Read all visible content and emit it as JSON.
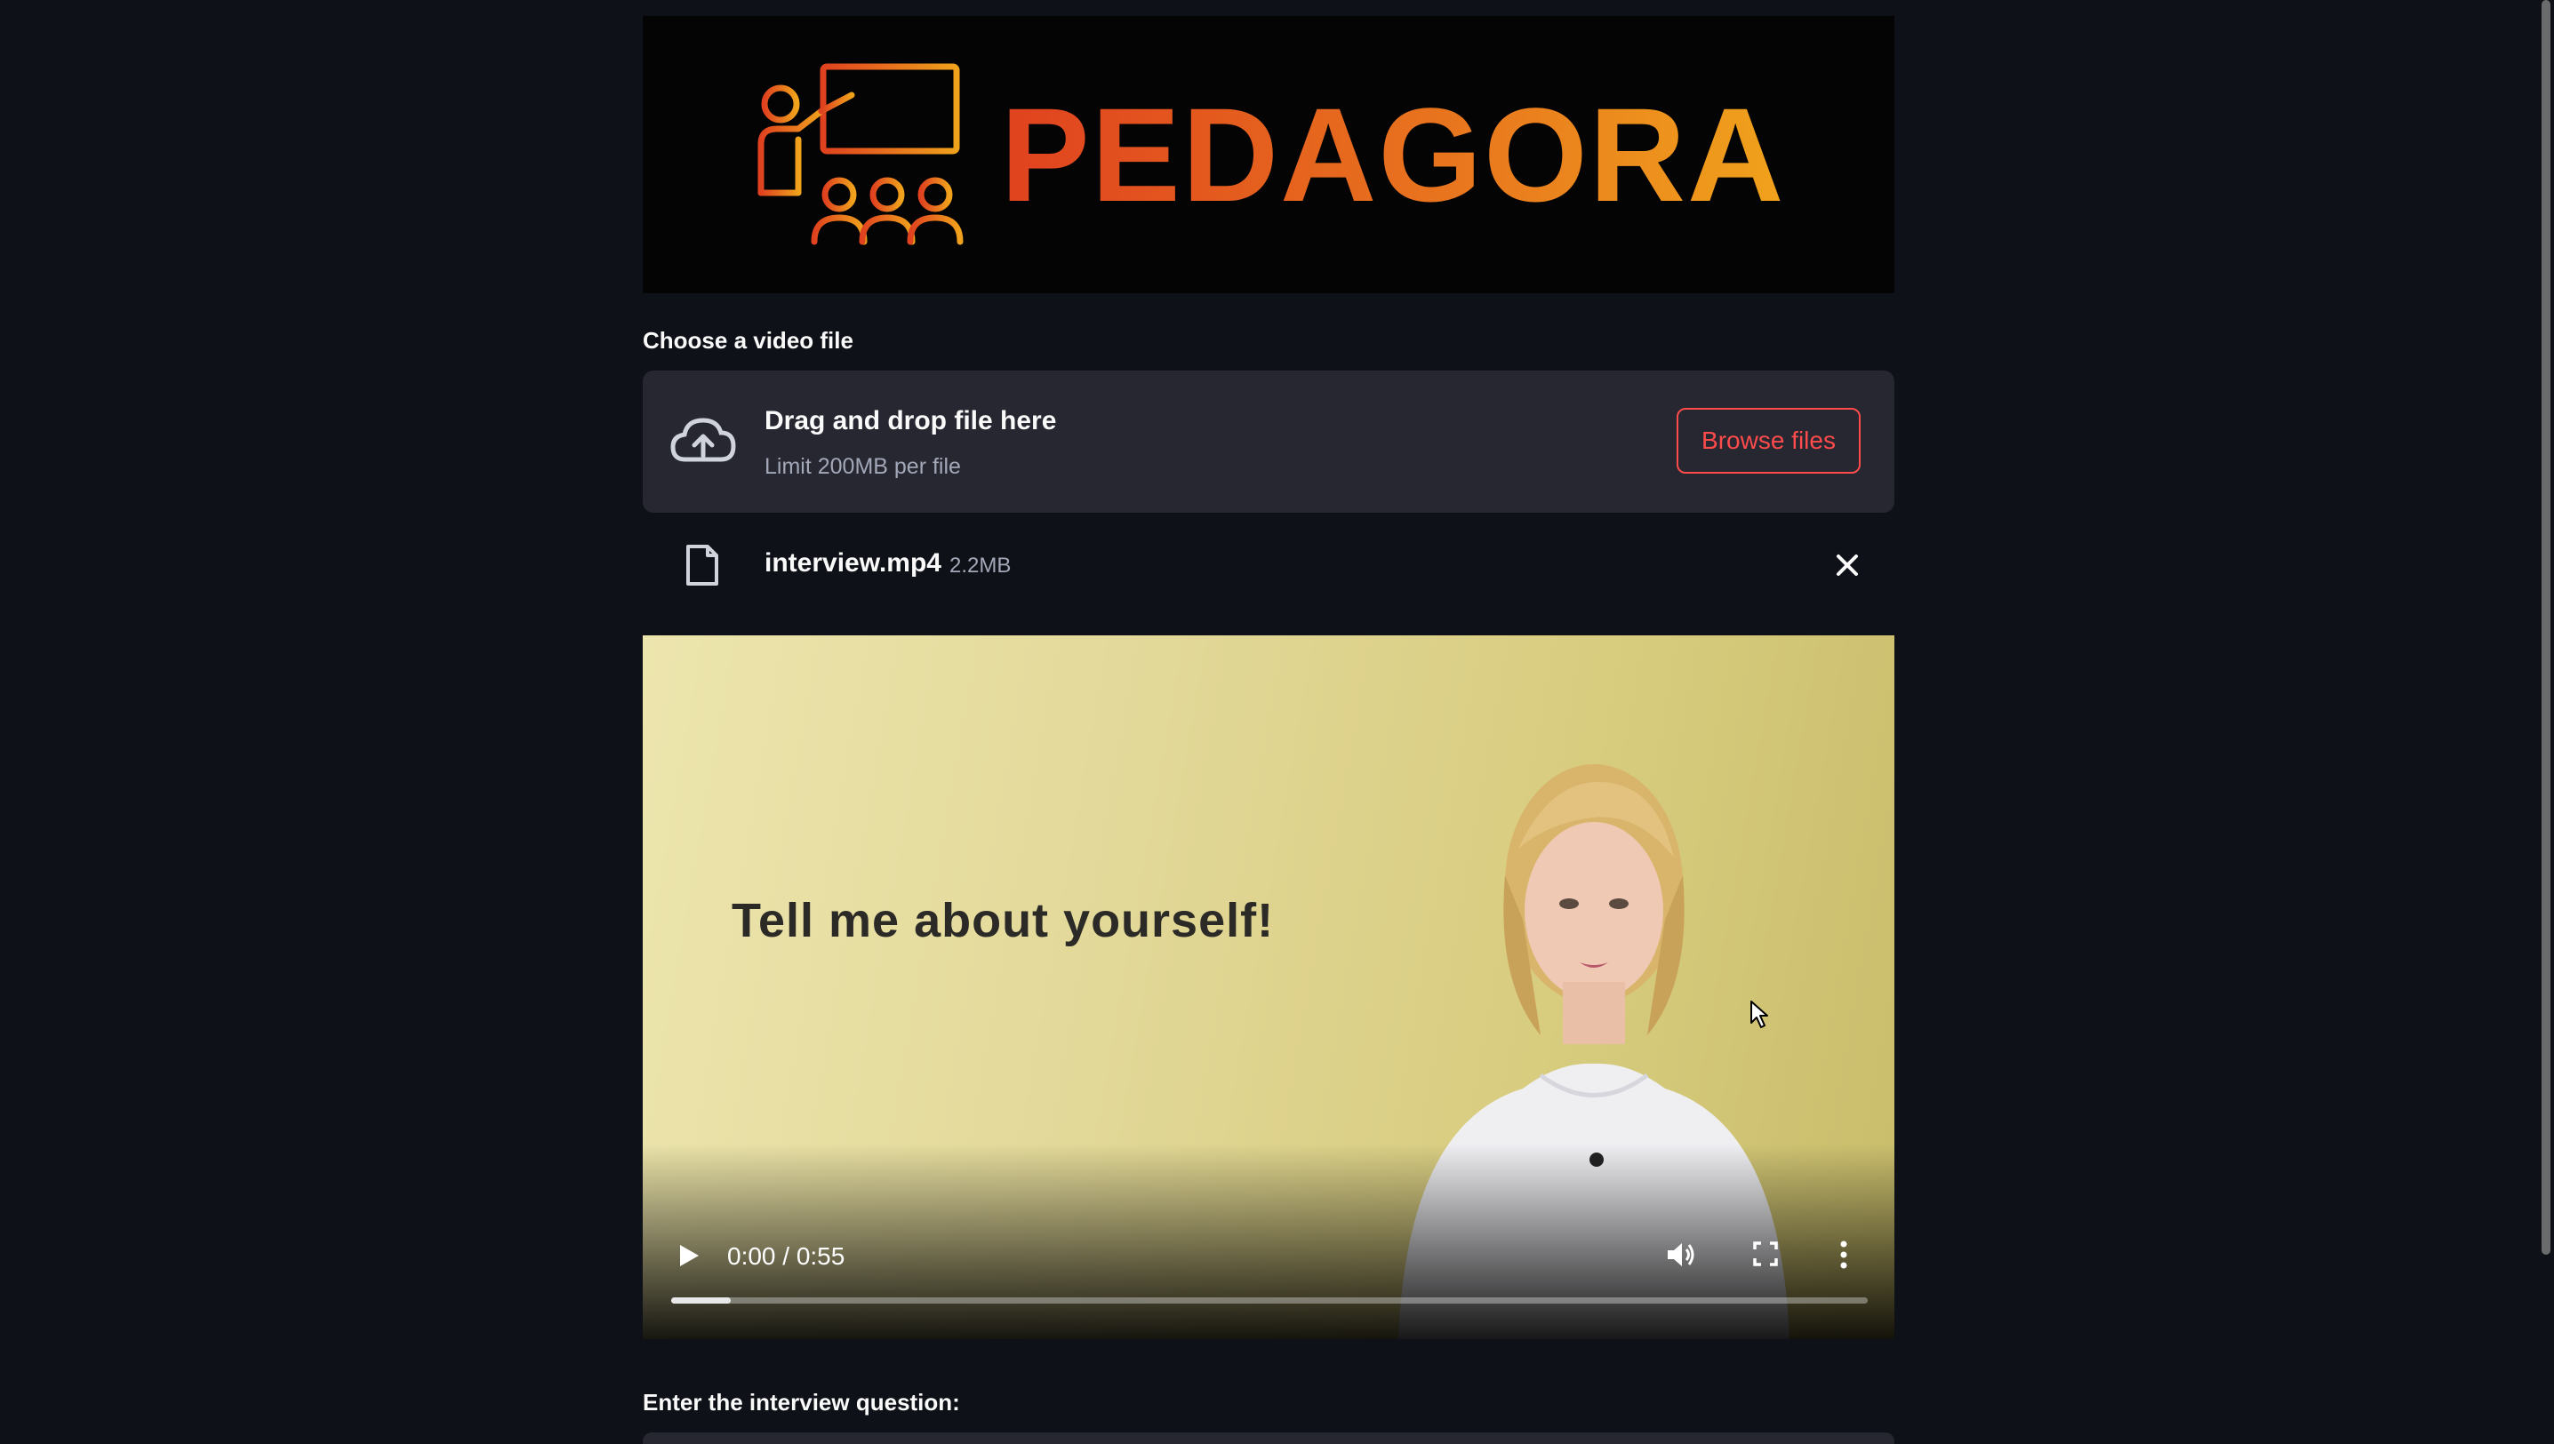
{
  "banner": {
    "brand": "PEDAGORA",
    "logo_icon": "teacher-presentation-icon"
  },
  "uploader": {
    "label": "Choose a video file",
    "drop_title": "Drag and drop file here",
    "drop_limit": "Limit 200MB per file",
    "browse_label": "Browse files",
    "icon": "cloud-upload-icon"
  },
  "uploaded_file": {
    "name": "interview.mp4",
    "size": "2.2MB",
    "icon": "file-icon",
    "remove_icon": "close-icon"
  },
  "video": {
    "caption": "Tell me about yourself!",
    "time": "0:00 / 0:55",
    "progress_fraction": 0.05
  },
  "question": {
    "label": "Enter the interview question:"
  },
  "colors": {
    "background": "#0e1117",
    "panel": "#262730",
    "accent": "#ff4b4b",
    "brand_start": "#e0421f",
    "brand_end": "#f0a21c"
  }
}
